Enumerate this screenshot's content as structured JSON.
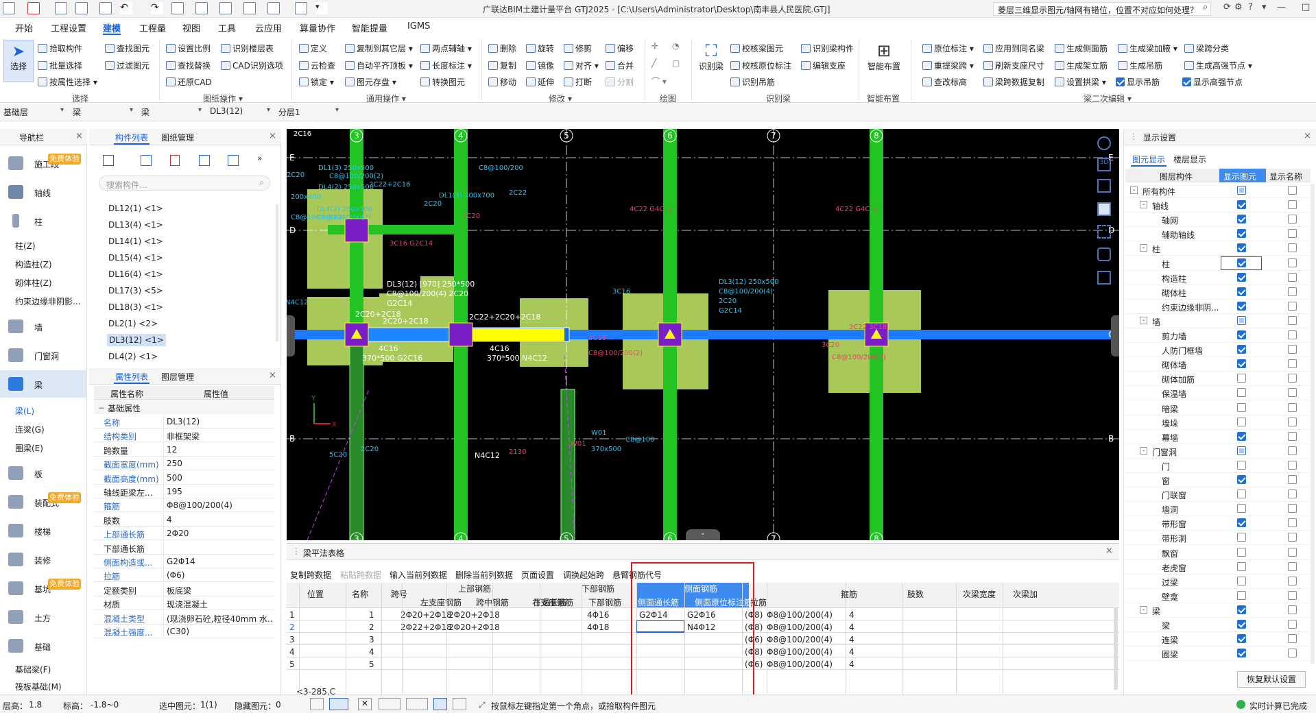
{
  "window": {
    "title": "广联达BIM土建计量平台 GTJ2025 - [C:\\Users\\Administrator\\Desktop\\南丰县人民医院.GTJ]",
    "help_search": "菱层三维显示图元/轴网有错位，位置不对应如何处理？"
  },
  "menu": [
    "开始",
    "工程设置",
    "建模",
    "工程量",
    "视图",
    "工具",
    "云应用",
    "算量协作",
    "智能提量",
    "IGMS"
  ],
  "menu_active": "建模",
  "ribbon": {
    "select_big": "选择",
    "select_group": "选择",
    "select_items": [
      "拾取构件",
      "批量选择",
      "按属性选择"
    ],
    "find_items": [
      "查找图元",
      "过滤图元"
    ],
    "drawing_items": [
      "设置比例",
      "识别楼层表",
      "查找替换",
      "CAD识别选项",
      "还原CAD"
    ],
    "drawing_group": "图纸操作",
    "common_items": [
      "定义",
      "复制到其它层",
      "两点辅轴",
      "云检查",
      "自动平齐顶板",
      "长度标注",
      "锁定",
      "图元存盘",
      "转换图元"
    ],
    "common_group": "通用操作",
    "modify_items": [
      "删除",
      "旋转",
      "修剪",
      "偏移",
      "复制",
      "镜像",
      "对齐",
      "合并",
      "移动",
      "延伸",
      "打断",
      "分割"
    ],
    "modify_group": "修改",
    "draw_group": "绘图",
    "recog_big": "识别梁",
    "recog_items": [
      "校核梁图元",
      "识别梁构件",
      "校核原位标注",
      "编辑支座",
      "识别吊筋"
    ],
    "recog_group": "识别梁",
    "smart_big": "智能布置",
    "smart_group": "智能布置",
    "beam_items": [
      "原位标注",
      "应用到同名梁",
      "生成侧面筋",
      "生成梁加腋",
      "梁跨分类",
      "重提梁跨",
      "刷新支座尺寸",
      "生成架立筋",
      "生成吊筋",
      "生成高强节点",
      "查改标高",
      "梁跨数据复制",
      "设置拱梁",
      "显示吊筋",
      "显示高强节点"
    ],
    "beam_group": "梁二次编辑"
  },
  "layer_bar": [
    "基础层",
    "梁",
    "梁",
    "DL3(12)",
    "分层1"
  ],
  "nav": {
    "title": "导航栏",
    "free_badge": "免费体验",
    "items": [
      {
        "label": "施工段",
        "sub": []
      },
      {
        "label": "轴线",
        "sub": []
      },
      {
        "label": "柱",
        "sub": [
          "柱(Z)",
          "构造柱(Z)",
          "砌体柱(Z)",
          "约束边缘非阴影..."
        ]
      },
      {
        "label": "墙",
        "sub": []
      },
      {
        "label": "门窗洞",
        "sub": []
      },
      {
        "label": "梁",
        "sub": [
          "梁(L)",
          "连梁(G)",
          "圈梁(E)"
        ]
      },
      {
        "label": "板",
        "sub": []
      },
      {
        "label": "装配式",
        "sub": []
      },
      {
        "label": "楼梯",
        "sub": []
      },
      {
        "label": "装修",
        "sub": []
      },
      {
        "label": "基坑",
        "sub": []
      },
      {
        "label": "土方",
        "sub": []
      },
      {
        "label": "基础",
        "sub": [
          "基础梁(F)",
          "筏板基础(M)"
        ]
      }
    ]
  },
  "component_panel": {
    "tabs": [
      "构件列表",
      "图纸管理"
    ],
    "search_placeholder": "搜索构件...",
    "items": [
      "DL12(1) <1>",
      "DL13(4) <1>",
      "DL14(1) <1>",
      "DL15(4) <1>",
      "DL16(4) <1>",
      "DL17(3) <5>",
      "DL18(3) <1>",
      "DL2(1) <2>",
      "DL3(12) <1>",
      "DL4(2) <1>"
    ],
    "selected": "DL3(12) <1>"
  },
  "property_panel": {
    "tabs": [
      "属性列表",
      "图层管理"
    ],
    "col_name": "属性名称",
    "col_value": "属性值",
    "group": "基础属性",
    "rows": [
      {
        "name": "名称",
        "value": "DL3(12)"
      },
      {
        "name": "结构类别",
        "value": "非框架梁"
      },
      {
        "name": "跨数量",
        "value": "12"
      },
      {
        "name": "截面宽度(mm)",
        "value": "250"
      },
      {
        "name": "截面高度(mm)",
        "value": "500"
      },
      {
        "name": "轴线距梁左...",
        "value": "195"
      },
      {
        "name": "箍筋",
        "value": "Φ8@100/200(4)"
      },
      {
        "name": "肢数",
        "value": "4"
      },
      {
        "name": "上部通长筋",
        "value": "2Φ20"
      },
      {
        "name": "下部通长筋",
        "value": ""
      },
      {
        "name": "侧面构造或...",
        "value": "G2Φ14"
      },
      {
        "name": "拉筋",
        "value": "(Φ6)"
      },
      {
        "name": "定额类别",
        "value": "板底梁"
      },
      {
        "name": "材质",
        "value": "现浇混凝土"
      },
      {
        "name": "混凝土类型",
        "value": "(现浇卵石砼,粒径40mm 水..."
      },
      {
        "name": "混凝土强度...",
        "value": "(C30)"
      }
    ]
  },
  "cad": {
    "axis_top": [
      "3",
      "4",
      "5",
      "6",
      "7",
      "8"
    ],
    "axis_left": [
      "E",
      "D",
      "C",
      "B"
    ],
    "annotations": [
      "DL3(12) [970] 250*500",
      "C8@100/200(4) 2C20",
      "G2C14",
      "2C20+2C18",
      "2C20+2C18",
      "2C22+2C20+2C18",
      "4C16",
      "370*500 G2C16",
      "4C16",
      "370*500 N4C12",
      "DL3(12) 250x500",
      "C8@100/200(4)",
      "2C20",
      "G2C14",
      "3C20",
      "C8@100/200(2)",
      "2C18",
      "C8@100/200(2)",
      "3C16 G2C14",
      "2C20",
      "4C22 G4C12",
      "4C22 G4C12",
      "DL4(2) 250x500",
      "C8@100/200(2)",
      "DL1(3) 300x700",
      "DL1(3) 250x500",
      "DL4(2) 250x500",
      "C8@100/200(2)",
      "2C22+2C16",
      "2C20",
      "N4C12",
      "200x400",
      "C8@100/200(2)",
      "2C20",
      "C8@100/200",
      "2C22",
      "N4C12",
      "2130",
      "W01",
      "W01",
      "370x500",
      "C8@100",
      "5C20",
      "3C16",
      "3C22 3C18",
      "2C20",
      "2C16"
    ]
  },
  "beam_table": {
    "title": "梁平法表格",
    "toolbar": [
      "复制跨数据",
      "粘贴跨数据",
      "输入当前列数据",
      "删除当前列数据",
      "页面设置",
      "调换起始跨",
      "悬臂钢筋代号"
    ],
    "group_headers": [
      "上部钢筋",
      "下部钢筋",
      "侧面钢筋"
    ],
    "columns": [
      "位置",
      "名称",
      "跨号",
      "左支座钢筋",
      "跨中钢筋",
      "右支座钢筋",
      "下通长筋",
      "下部钢筋",
      "侧面通长筋",
      "侧面原位标注筋",
      "拉筋",
      "箍筋",
      "肢数",
      "次梁宽度",
      "次梁加"
    ],
    "position_value": "<3-285,C",
    "rows": [
      {
        "n": "1",
        "span": "1",
        "left": "2Φ20+2Φ18",
        "mid": "2Φ20+2Φ18",
        "right": "",
        "botlong": "",
        "bot": "4Φ16",
        "side": "G2Φ14",
        "sidein": "G2Φ16",
        "tie": "(Φ8)",
        "stir": "Φ8@100/200(4)",
        "legs": "4"
      },
      {
        "n": "2",
        "span": "2",
        "left": "2Φ22+2Φ18",
        "mid": "2Φ20+2Φ18",
        "right": "",
        "botlong": "",
        "bot": "4Φ18",
        "side": "",
        "sidein": "N4Φ12",
        "tie": "(Φ8)",
        "stir": "Φ8@100/200(4)",
        "legs": "4"
      },
      {
        "n": "3",
        "span": "3",
        "left": "",
        "mid": "",
        "right": "",
        "botlong": "",
        "bot": "",
        "side": "",
        "sidein": "",
        "tie": "(Φ6)",
        "stir": "Φ8@100/200(4)",
        "legs": "4"
      },
      {
        "n": "4",
        "span": "4",
        "left": "",
        "mid": "",
        "right": "",
        "botlong": "",
        "bot": "",
        "side": "",
        "sidein": "",
        "tie": "(Φ8)",
        "stir": "Φ8@100/200(4)",
        "legs": "4"
      },
      {
        "n": "5",
        "span": "5",
        "left": "",
        "mid": "",
        "right": "",
        "botlong": "",
        "bot": "",
        "side": "",
        "sidein": "",
        "tie": "(Φ6)",
        "stir": "Φ8@100/200(4)",
        "legs": "4"
      }
    ]
  },
  "display_panel": {
    "title": "显示设置",
    "tabs": [
      "图元显示",
      "楼层显示"
    ],
    "col_headers": [
      "图层构件",
      "显示图元",
      "显示名称"
    ],
    "restore_button": "恢复默认设置",
    "rows": [
      {
        "label": "所有构件",
        "level": 0,
        "toggle": "-",
        "a": "part",
        "b": "off"
      },
      {
        "label": "轴线",
        "level": 1,
        "toggle": "-",
        "a": "on",
        "b": "off"
      },
      {
        "label": "轴网",
        "level": 2,
        "toggle": "",
        "a": "on",
        "b": "off"
      },
      {
        "label": "辅助轴线",
        "level": 2,
        "toggle": "",
        "a": "on",
        "b": "off"
      },
      {
        "label": "柱",
        "level": 1,
        "toggle": "-",
        "a": "on",
        "b": "off"
      },
      {
        "label": "柱",
        "level": 2,
        "toggle": "",
        "a": "on",
        "b": "off"
      },
      {
        "label": "构造柱",
        "level": 2,
        "toggle": "",
        "a": "on",
        "b": "off"
      },
      {
        "label": "砌体柱",
        "level": 2,
        "toggle": "",
        "a": "on",
        "b": "off"
      },
      {
        "label": "约束边缘非阴...",
        "level": 2,
        "toggle": "",
        "a": "on",
        "b": "off"
      },
      {
        "label": "墙",
        "level": 1,
        "toggle": "-",
        "a": "part",
        "b": "off"
      },
      {
        "label": "剪力墙",
        "level": 2,
        "toggle": "",
        "a": "on",
        "b": "off"
      },
      {
        "label": "人防门框墙",
        "level": 2,
        "toggle": "",
        "a": "on",
        "b": "off"
      },
      {
        "label": "砌体墙",
        "level": 2,
        "toggle": "",
        "a": "on",
        "b": "off"
      },
      {
        "label": "砌体加筋",
        "level": 2,
        "toggle": "",
        "a": "off",
        "b": "off"
      },
      {
        "label": "保温墙",
        "level": 2,
        "toggle": "",
        "a": "off",
        "b": "off"
      },
      {
        "label": "暗梁",
        "level": 2,
        "toggle": "",
        "a": "off",
        "b": "off"
      },
      {
        "label": "墙垛",
        "level": 2,
        "toggle": "",
        "a": "off",
        "b": "off"
      },
      {
        "label": "幕墙",
        "level": 2,
        "toggle": "",
        "a": "on",
        "b": "off"
      },
      {
        "label": "门窗洞",
        "level": 1,
        "toggle": "-",
        "a": "part",
        "b": "off"
      },
      {
        "label": "门",
        "level": 2,
        "toggle": "",
        "a": "off",
        "b": "off"
      },
      {
        "label": "窗",
        "level": 2,
        "toggle": "",
        "a": "on",
        "b": "off"
      },
      {
        "label": "门联窗",
        "level": 2,
        "toggle": "",
        "a": "off",
        "b": "off"
      },
      {
        "label": "墙洞",
        "level": 2,
        "toggle": "",
        "a": "off",
        "b": "off"
      },
      {
        "label": "带形窗",
        "level": 2,
        "toggle": "",
        "a": "on",
        "b": "off"
      },
      {
        "label": "带形洞",
        "level": 2,
        "toggle": "",
        "a": "off",
        "b": "off"
      },
      {
        "label": "飘窗",
        "level": 2,
        "toggle": "",
        "a": "off",
        "b": "off"
      },
      {
        "label": "老虎窗",
        "level": 2,
        "toggle": "",
        "a": "off",
        "b": "off"
      },
      {
        "label": "过梁",
        "level": 2,
        "toggle": "",
        "a": "off",
        "b": "off"
      },
      {
        "label": "壁龛",
        "level": 2,
        "toggle": "",
        "a": "off",
        "b": "off"
      },
      {
        "label": "梁",
        "level": 1,
        "toggle": "-",
        "a": "on",
        "b": "off"
      },
      {
        "label": "梁",
        "level": 2,
        "toggle": "",
        "a": "on",
        "b": "off"
      },
      {
        "label": "连梁",
        "level": 2,
        "toggle": "",
        "a": "on",
        "b": "off"
      },
      {
        "label": "圈梁",
        "level": 2,
        "toggle": "",
        "a": "on",
        "b": "off"
      }
    ]
  },
  "status": {
    "floor_height_label": "层高：",
    "floor_height": "1.8",
    "elevation_label": "标高：",
    "elevation": "-1.8~0",
    "selected_label": "选中图元：",
    "selected": "1(1)",
    "hidden_label": "隐藏图元：",
    "hidden": "0",
    "hint": "按鼠标左键指定第一个角点，或拾取构件图元",
    "calc": "实时计算已完成"
  },
  "colors": {
    "accent": "#1d63d8",
    "beam_green": "#22c322",
    "beam_blue": "#1e7bff",
    "column_purple": "#7a1ec8",
    "highlight_red": "#e01a1a",
    "cad_bg": "#000000"
  }
}
